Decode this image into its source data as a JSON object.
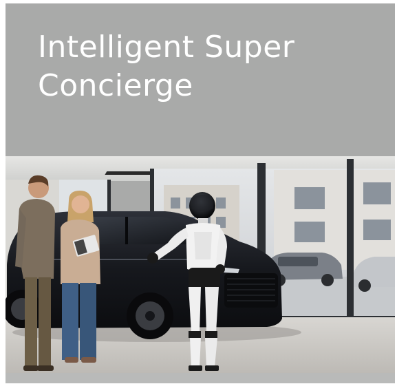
{
  "card": {
    "title": "Intelligent Super\nConcierge"
  },
  "photo": {
    "subject": "humanoid-robot-presenting-black-minivan-to-couple-in-showroom"
  },
  "colors": {
    "card_background": "#a9aaa9",
    "title_text": "#ffffff",
    "vehicle": "#1b1d22",
    "robot_body": "#f2f2f2",
    "robot_accent": "#1a1a1a"
  }
}
